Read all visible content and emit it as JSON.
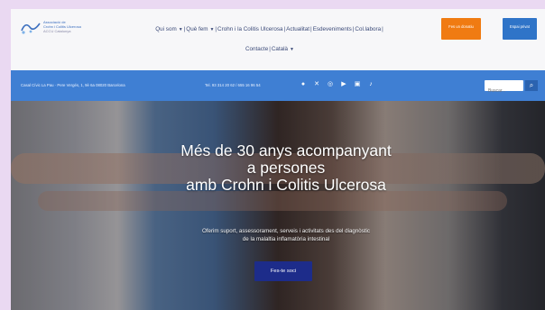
{
  "header": {
    "logo_lines": [
      "Associació de",
      "Crohn i Colitis Ulcerosa",
      "ACCU Catalunya"
    ],
    "nav": [
      {
        "label": "Qui som",
        "dropdown": true
      },
      {
        "label": "Què fem",
        "dropdown": true
      },
      {
        "label": "Crohn i la Colitis Ulcerosa",
        "dropdown": false
      },
      {
        "label": "Actualitat",
        "dropdown": false
      },
      {
        "label": "Esdeveniments",
        "dropdown": false
      },
      {
        "label": "Col.labora",
        "dropdown": false
      },
      {
        "label": "Contacte",
        "dropdown": false
      },
      {
        "label": "Català",
        "dropdown": true
      }
    ],
    "donate_button": "Fes un donatiu",
    "private_button": "Espai privat",
    "colors": {
      "donate": "#f07b12",
      "private": "#2f74c8"
    }
  },
  "infobar": {
    "address": "Casal Cívic La Pau · Pere Vergés, 1, 9è 6a 08020 Barcelona",
    "phone": "Tel. 93 314 20 62 / 655 16 96 54",
    "social_icons": [
      "facebook-icon",
      "x-icon",
      "instagram-icon",
      "youtube-icon",
      "linkedin-icon",
      "tiktok-icon"
    ],
    "search_placeholder": "Buscar...",
    "color": "#3f7fd3"
  },
  "hero": {
    "headline_1": "Més de 30 anys acompanyant",
    "headline_2": "a persones",
    "headline_3": "amb Crohn i Colitis Ulcerosa",
    "sub_1": "Oferim suport, assessorament, serveis i activitats des del diagnòstic",
    "sub_2": "de la malaltia inflamatòria intestinal",
    "cta": "Fes-te soci",
    "cta_color": "#1d2c8a"
  }
}
